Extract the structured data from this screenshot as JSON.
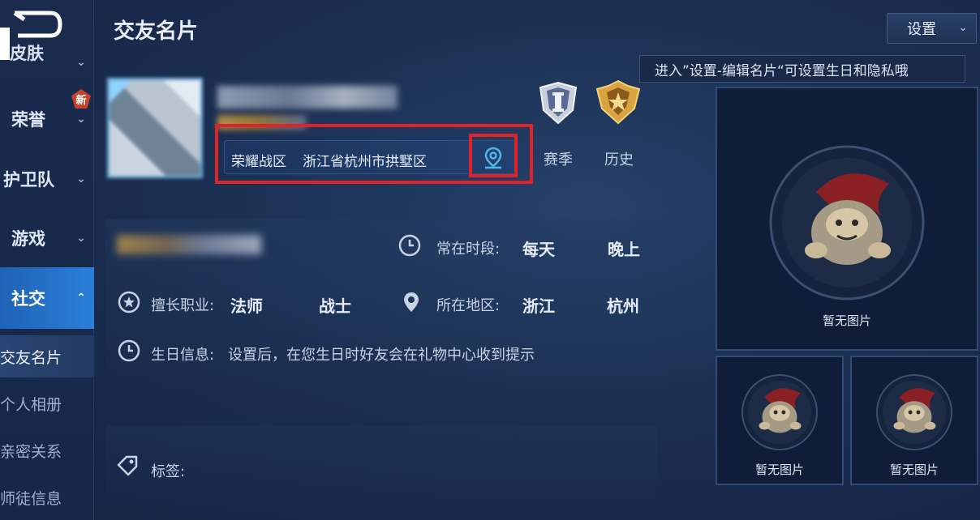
{
  "sidebar": {
    "items": [
      {
        "label": "皮肤"
      },
      {
        "label": "荣誉",
        "badge": "新"
      },
      {
        "label": "护卫队"
      },
      {
        "label": "游戏"
      },
      {
        "label": "社交"
      }
    ],
    "sub_items": [
      {
        "label": "交友名片"
      },
      {
        "label": "个人相册"
      },
      {
        "label": "亲密关系"
      },
      {
        "label": "师徒信息"
      }
    ]
  },
  "header": {
    "title": "交友名片",
    "settings_label": "设置",
    "tooltip": "进入”设置-编辑名片“可设置生日和隐私哦"
  },
  "profile": {
    "zone": "荣耀战区",
    "address": "浙江省杭州市拱墅区",
    "badges": [
      {
        "label": "赛季"
      },
      {
        "label": "历史"
      }
    ]
  },
  "info": {
    "active_time_label": "常在时段:",
    "active_time_values": [
      "每天",
      "晚上"
    ],
    "role_label": "擅长职业:",
    "role_values": [
      "法师",
      "战士"
    ],
    "region_label": "所在地区:",
    "region_values": [
      "浙江",
      "杭州"
    ],
    "birthday_label": "生日信息:",
    "birthday_text": "设置后，在您生日时好友会在礼物中心收到提示",
    "tags_label": "标签:"
  },
  "photos": {
    "empty_caption": "暂无图片"
  },
  "colors": {
    "accent": "#2b7fd8",
    "highlight_box": "#e0232b",
    "badge_new": "#c4422e"
  }
}
